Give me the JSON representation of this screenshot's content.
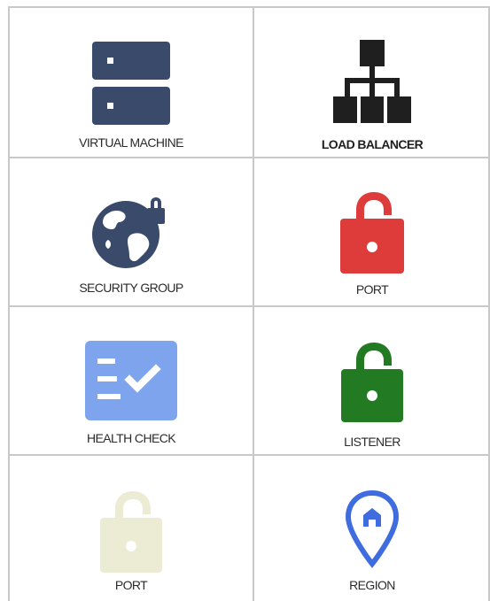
{
  "tiles": [
    {
      "label": "VIRTUAL MACHINE",
      "icon": "server-icon",
      "color": "#3a4a6b"
    },
    {
      "label": "LOAD BALANCER",
      "icon": "network-tree-icon",
      "color": "#1f1f1f"
    },
    {
      "label": "SECURITY GROUP",
      "icon": "globe-lock-icon",
      "color": "#3a4a6b"
    },
    {
      "label": "PORT",
      "icon": "unlocked-padlock-icon",
      "color": "#de3b3b"
    },
    {
      "label": "HEALTH CHECK",
      "icon": "checklist-icon",
      "color": "#7fa4ee"
    },
    {
      "label": "LISTENER",
      "icon": "unlocked-padlock-icon",
      "color": "#227a22"
    },
    {
      "label": "PORT",
      "icon": "unlocked-padlock-icon",
      "color": "#ecebd3"
    },
    {
      "label": "REGION",
      "icon": "location-pin-icon",
      "color": "#3f6de0"
    }
  ]
}
